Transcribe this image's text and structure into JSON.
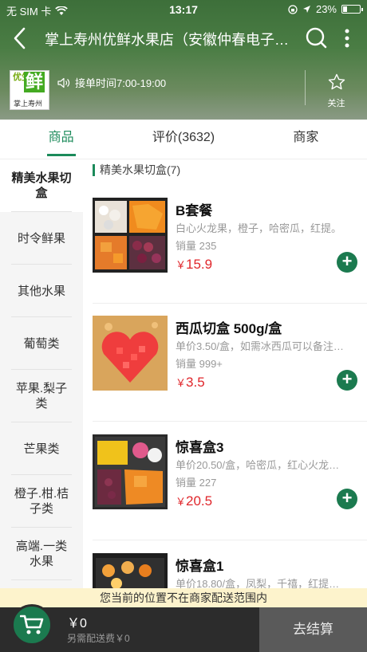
{
  "status_bar": {
    "carrier": "无 SIM 卡",
    "time": "13:17",
    "battery": "23%",
    "battery_level": 0.23
  },
  "header": {
    "title": "掌上寿州优鲜水果店（安徽仲春电子商务有限公司）",
    "hours": "接单时间7:00-19:00",
    "favorite_label": "关注"
  },
  "logo": {
    "line1": "优生",
    "line2": "鲜",
    "line3": "掌上寿州"
  },
  "tabs": [
    {
      "label": "商品"
    },
    {
      "label": "评价(3632)"
    },
    {
      "label": "商家"
    }
  ],
  "sidebar": {
    "items": [
      {
        "label": "精美水果切盒"
      },
      {
        "label": "时令鲜果"
      },
      {
        "label": "其他水果"
      },
      {
        "label": "葡萄类"
      },
      {
        "label": "苹果.梨子类"
      },
      {
        "label": "芒果类"
      },
      {
        "label": "橙子.柑.桔子类"
      },
      {
        "label": "高端.一类水果"
      }
    ]
  },
  "section": {
    "title": "精美水果切盒(7)"
  },
  "products": [
    {
      "name": "B套餐",
      "desc": "白心火龙果，橙子，哈密瓜，红提。",
      "sales": "销量 235",
      "currency": "￥",
      "price": "15.9"
    },
    {
      "name": "西瓜切盒 500g/盒",
      "desc": "单价3.50/盒，如需冰西瓜可以备注…",
      "sales": "销量 999+",
      "currency": "￥",
      "price": "3.5"
    },
    {
      "name": "惊喜盒3",
      "desc": "单价20.50/盒，哈密瓜，红心火龙…",
      "sales": "销量 227",
      "currency": "￥",
      "price": "20.5"
    },
    {
      "name": "惊喜盒1",
      "desc": "单价18.80/盒，凤梨，千禧，红提…",
      "sales": "",
      "currency": "",
      "price": ""
    }
  ],
  "notice": "您当前的位置不在商家配送范围内",
  "cart": {
    "amount": "￥0",
    "delivery_fee": "另需配送费￥0",
    "checkout_label": "去结算"
  },
  "colors": {
    "accent": "#1b8a5a",
    "price": "#e0262b",
    "add_button": "#1b7a4f",
    "notice_bg": "#fdf3cc"
  }
}
